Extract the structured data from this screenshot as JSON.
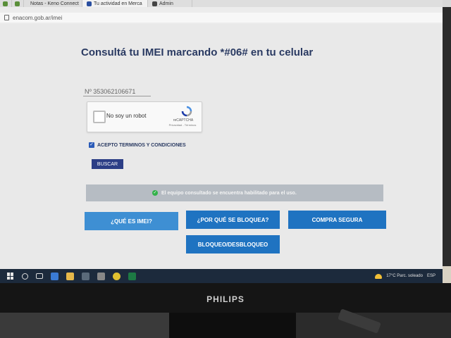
{
  "browser": {
    "tabs": [
      {
        "label": "",
        "color": "#5a8f3a"
      },
      {
        "label": "",
        "color": "#5a8f3a"
      },
      {
        "label": "Notas - Keno Connect",
        "color": "#3d6fd1"
      },
      {
        "label": "Tu actividad en Merca",
        "color": "#2a4fa0"
      },
      {
        "label": "Admin",
        "color": "#444444"
      }
    ],
    "url": "enacom.gob.ar/imei"
  },
  "page": {
    "title": "Consultá tu IMEI marcando *#06# en tu celular",
    "imei_value": "Nº 353062106671",
    "captcha": {
      "label": "No soy un robot",
      "brand": "reCAPTCHA",
      "terms": "Privacidad - Términos"
    },
    "accept_label": "ACEPTO TERMINOS Y CONDICIONES",
    "search_label": "BUSCAR",
    "status_text": "El equipo consultado se encuentra habilitado para el uso.",
    "buttons": {
      "what": "¿QUÉ ES IMEI?",
      "why": "¿POR QUÉ SE BLOQUEA?",
      "buy": "COMPRA SEGURA",
      "lock": "BLOQUEO/DESBLOQUEO"
    },
    "colors": {
      "accent": "#1f73c1",
      "title": "#2a3a62",
      "search": "#2c3e86",
      "ok": "#33b24a"
    }
  },
  "taskbar": {
    "weather": "17°C  Parc. soleado",
    "lang": "ESP"
  },
  "monitor": {
    "brand": "PHILIPS"
  }
}
